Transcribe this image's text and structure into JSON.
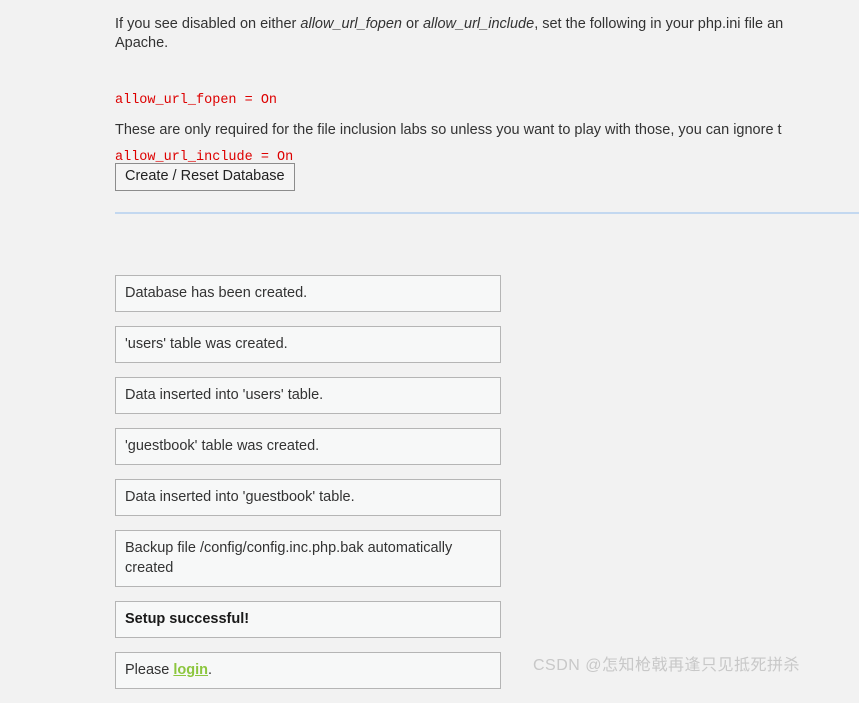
{
  "intro": {
    "before_first_param": "If you see disabled on either ",
    "param_one": "allow_url_fopen",
    "between_params": " or ",
    "param_two": "allow_url_include",
    "after_params": ", set the following in your php.ini file an",
    "line_two": "Apache."
  },
  "code": {
    "line_one": "allow_url_fopen = On",
    "line_two": "allow_url_include = On"
  },
  "note": {
    "text": "These are only required for the file inclusion labs so unless you want to play with those, you can ignore t"
  },
  "toolbar": {
    "reset_button_label": "Create / Reset Database"
  },
  "results": {
    "items": [
      {
        "text": "Database has been created.",
        "bold": false
      },
      {
        "text": "'users' table was created.",
        "bold": false
      },
      {
        "text": "Data inserted into 'users' table.",
        "bold": false
      },
      {
        "text": "'guestbook' table was created.",
        "bold": false
      },
      {
        "text": "Data inserted into 'guestbook' table.",
        "bold": false
      },
      {
        "text": "Backup file /config/config.inc.php.bak automatically created",
        "bold": false
      },
      {
        "text": "Setup successful!",
        "bold": true
      }
    ],
    "login_row": {
      "prefix": "Please ",
      "link_label": "login",
      "suffix": "."
    }
  },
  "watermark": {
    "text": "CSDN @怎知枪戟再逢只见抵死拼杀"
  },
  "colors": {
    "page_background": "#f2f2f2",
    "code_red": "#dd0000",
    "divider_blue": "#c3d8f0",
    "box_border": "#b5b5b5",
    "box_fill": "#f7f8f8",
    "link_green": "#8cc63e",
    "watermark_gray": "#c8c8c8"
  }
}
